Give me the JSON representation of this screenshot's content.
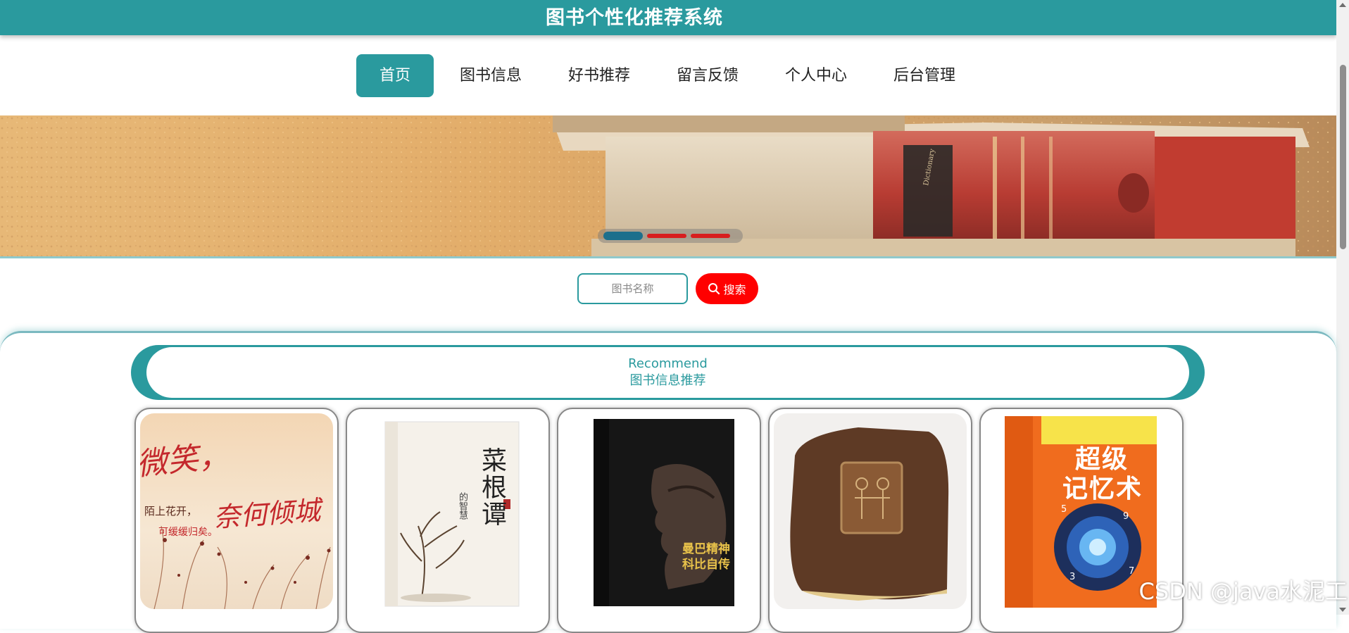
{
  "header": {
    "title": "图书个性化推荐系统"
  },
  "nav": {
    "items": [
      {
        "label": "首页",
        "active": true
      },
      {
        "label": "图书信息",
        "active": false
      },
      {
        "label": "好书推荐",
        "active": false
      },
      {
        "label": "留言反馈",
        "active": false
      },
      {
        "label": "个人中心",
        "active": false
      },
      {
        "label": "后台管理",
        "active": false
      }
    ]
  },
  "carousel": {
    "slide_count": 3,
    "active_index": 0
  },
  "search": {
    "placeholder": "图书名称",
    "button_label": "搜索"
  },
  "recommend": {
    "title_en": "Recommend",
    "title_cn": "图书信息推荐"
  },
  "books": [
    {
      "cover": "calligraphy-cover",
      "cover_text": [
        "微笑，",
        "陌上花开，",
        "奈何倾城",
        "可缓缓归矣。"
      ]
    },
    {
      "cover": "caigentan-cover",
      "cover_text": [
        "菜根谭",
        "的智慧"
      ]
    },
    {
      "cover": "kobe-cover",
      "cover_text": [
        "曼巴精神",
        "科比自传"
      ]
    },
    {
      "cover": "leather-book-cover",
      "cover_text": []
    },
    {
      "cover": "memory-book-cover",
      "cover_text": [
        "超级",
        "记忆术"
      ]
    }
  ],
  "watermark": "CSDN @java水泥工",
  "colors": {
    "primary": "#2a9a9e",
    "search_button": "#ff0000",
    "carousel_active": "#1c6f8c",
    "carousel_inactive": "#d81e1e"
  }
}
